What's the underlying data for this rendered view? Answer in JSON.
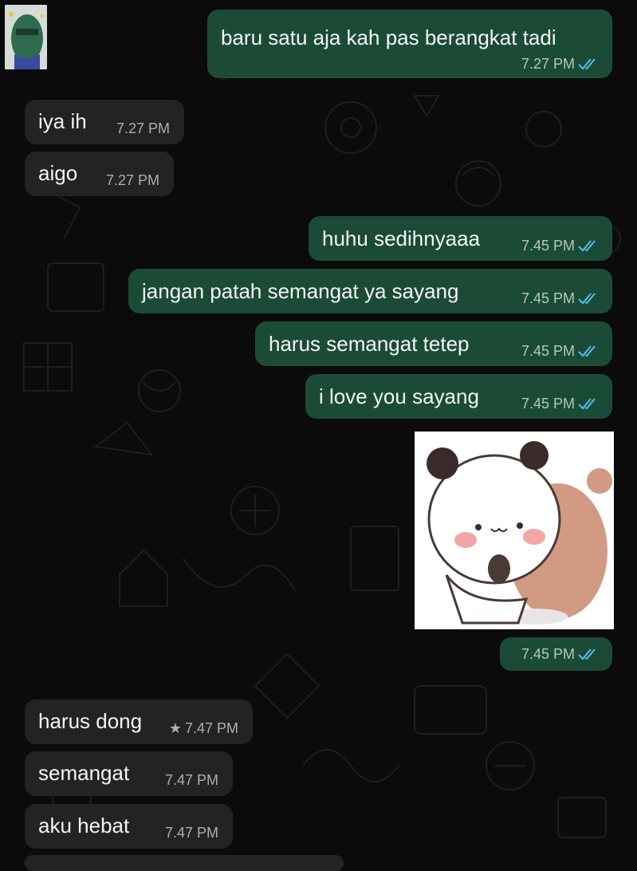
{
  "chat": {
    "messages": [
      {
        "text": "baru satu aja kah pas berangkat tadi",
        "time": "7.27 PM"
      },
      {
        "text": "iya ih",
        "time": "7.27 PM"
      },
      {
        "text": "aigo",
        "time": "7.27 PM"
      },
      {
        "text": "huhu sedihnyaaa",
        "time": "7.45 PM"
      },
      {
        "text": "jangan patah semangat ya sayang",
        "time": "7.45 PM"
      },
      {
        "text": "harus semangat tetep",
        "time": "7.45 PM"
      },
      {
        "text": "i love you sayang",
        "time": "7.45 PM"
      },
      {
        "text": "",
        "time": "7.45 PM"
      },
      {
        "text": "harus dong",
        "time": "7.47 PM",
        "starred": true
      },
      {
        "text": "semangat",
        "time": "7.47 PM"
      },
      {
        "text": "aku hebat",
        "time": "7.47 PM"
      }
    ]
  },
  "colors": {
    "outgoing_bubble": "#1b4b37",
    "incoming_bubble": "#222323",
    "read_ticks": "#53bdeb",
    "background": "#0b0b0b"
  },
  "icons": {
    "read_receipt": "double-check-icon",
    "starred": "star-icon"
  }
}
